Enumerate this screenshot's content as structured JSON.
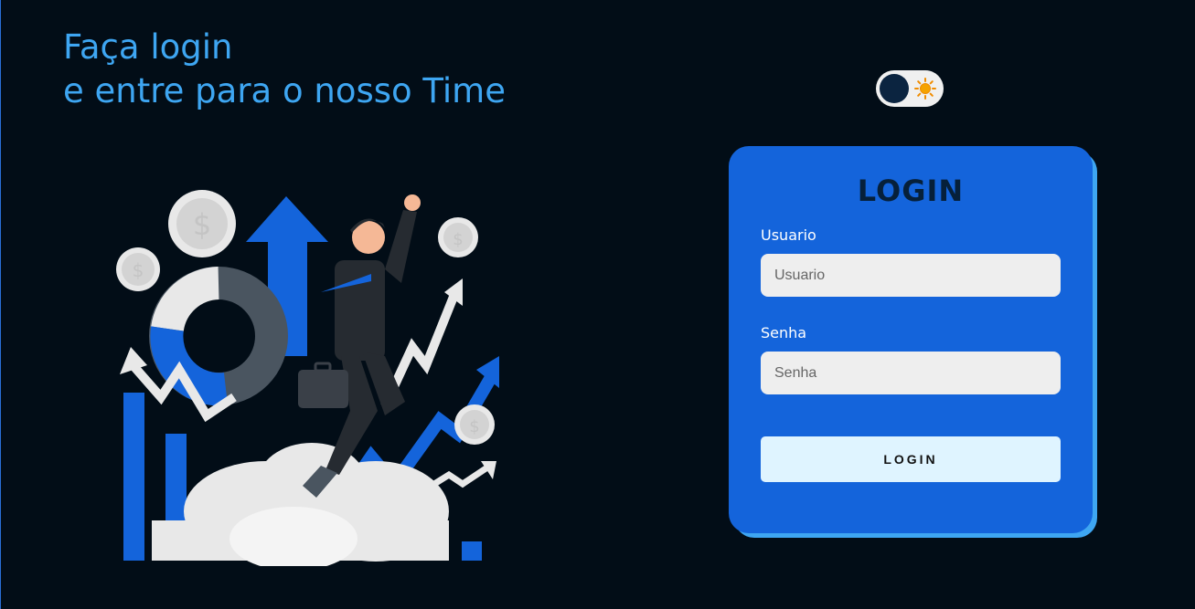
{
  "hero": {
    "line1": "Faça login",
    "line2": "e entre para o nosso Time"
  },
  "theme_toggle": {
    "icon": "sun-icon",
    "state": "dark"
  },
  "login_card": {
    "title": "LOGIN",
    "username_label": "Usuario",
    "username_placeholder": "Usuario",
    "username_value": "",
    "password_label": "Senha",
    "password_placeholder": "Senha",
    "password_value": "",
    "submit_label": "LOGIN"
  },
  "colors": {
    "background": "#020d17",
    "accent": "#3ea6f2",
    "card": "#1464db",
    "button": "#dff4ff"
  }
}
